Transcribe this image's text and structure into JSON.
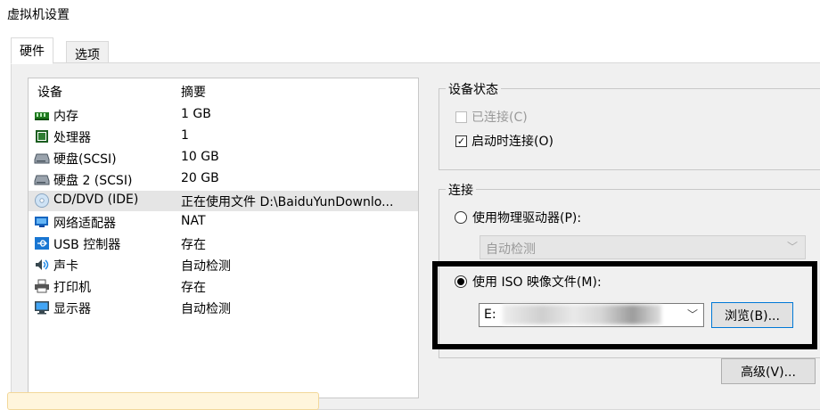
{
  "window": {
    "title": "虚拟机设置"
  },
  "tabs": [
    {
      "label": "硬件",
      "active": true
    },
    {
      "label": "选项",
      "active": false
    }
  ],
  "device_list": {
    "columns": [
      "设备",
      "摘要"
    ],
    "rows": [
      {
        "icon": "memory-icon",
        "name": "内存",
        "summary": "1 GB"
      },
      {
        "icon": "processor-icon",
        "name": "处理器",
        "summary": "1"
      },
      {
        "icon": "hard-disk-icon",
        "name": "硬盘(SCSI)",
        "summary": "10 GB"
      },
      {
        "icon": "hard-disk-icon",
        "name": "硬盘 2 (SCSI)",
        "summary": "20 GB"
      },
      {
        "icon": "cd-dvd-icon",
        "name": "CD/DVD (IDE)",
        "summary": "正在使用文件 D:\\BaiduYunDownlo...",
        "selected": true
      },
      {
        "icon": "network-adapter-icon",
        "name": "网络适配器",
        "summary": "NAT"
      },
      {
        "icon": "usb-icon",
        "name": "USB 控制器",
        "summary": "存在"
      },
      {
        "icon": "sound-card-icon",
        "name": "声卡",
        "summary": "自动检测"
      },
      {
        "icon": "printer-icon",
        "name": "打印机",
        "summary": "存在"
      },
      {
        "icon": "display-icon",
        "name": "显示器",
        "summary": "自动检测"
      }
    ]
  },
  "device_status": {
    "legend": "设备状态",
    "connected": {
      "label": "已连接(C)",
      "checked": false,
      "disabled": true
    },
    "connect_at_power_on": {
      "label": "启动时连接(O)",
      "checked": true
    }
  },
  "connection": {
    "legend": "连接",
    "physical_drive": {
      "label": "使用物理驱动器(P):",
      "selected": false
    },
    "drive_select": {
      "value": "自动检测",
      "disabled": true
    },
    "iso_image": {
      "label": "使用 ISO 映像文件(M):",
      "selected": true
    },
    "iso_path": {
      "value": "E:"
    },
    "browse_label": "浏览(B)..."
  },
  "advanced_label": "高级(V)...",
  "colors": {
    "panel": "#f0f0f0",
    "selected_row": "#e5e5e5",
    "focus_border": "#0078d7",
    "disabled_text": "#9a9a9a"
  }
}
